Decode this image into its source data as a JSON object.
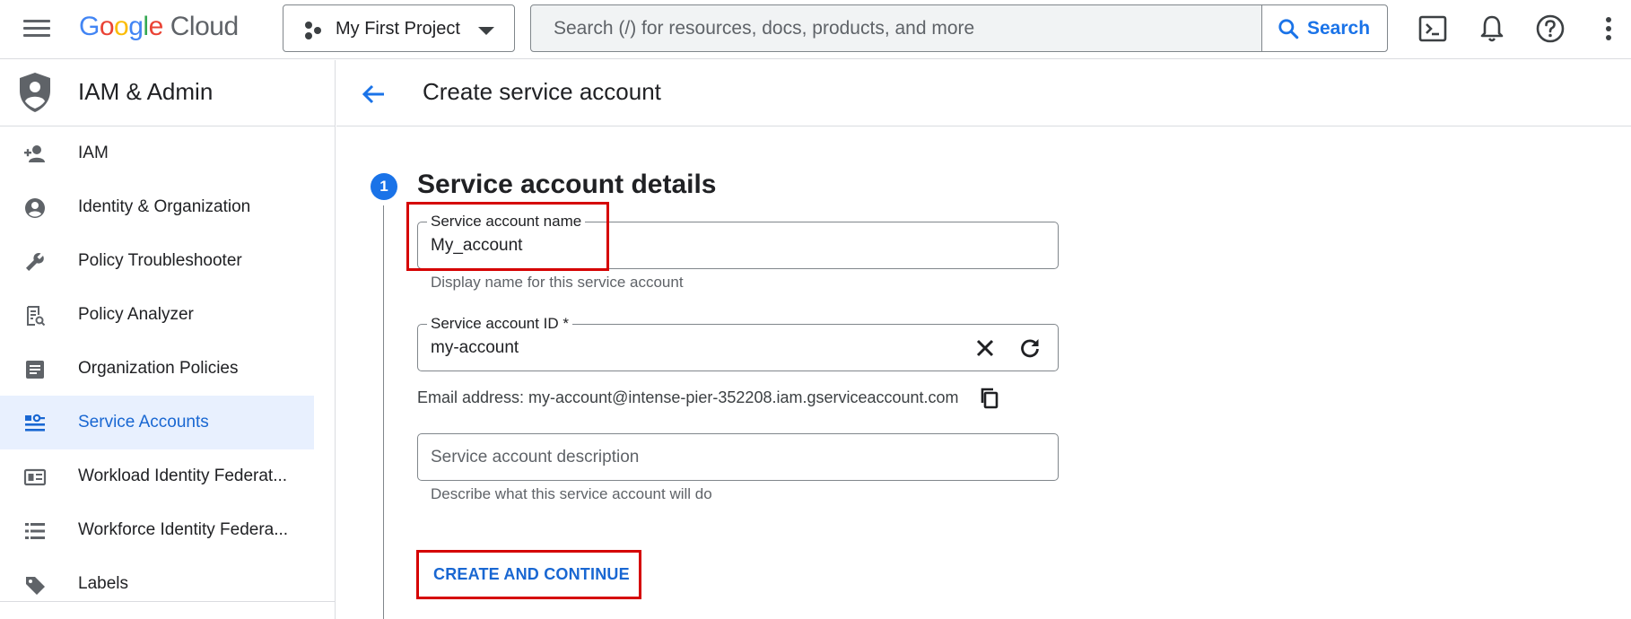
{
  "topbar": {
    "logo_google": "Google",
    "logo_cloud": "Cloud",
    "project_name": "My First Project",
    "search_placeholder": "Search (/) for resources, docs, products, and more",
    "search_button": "Search",
    "icons": [
      "menu-icon",
      "cloud-shell-icon",
      "notifications-icon",
      "help-icon",
      "more-vert-icon"
    ]
  },
  "sidebar": {
    "title": "IAM & Admin",
    "items": [
      {
        "label": "IAM",
        "icon": "person-add-icon"
      },
      {
        "label": "Identity & Organization",
        "icon": "account-circle-icon"
      },
      {
        "label": "Policy Troubleshooter",
        "icon": "wrench-icon"
      },
      {
        "label": "Policy Analyzer",
        "icon": "policy-doc-icon"
      },
      {
        "label": "Organization Policies",
        "icon": "article-icon"
      },
      {
        "label": "Service Accounts",
        "icon": "service-account-icon",
        "active": true
      },
      {
        "label": "Workload Identity Federat...",
        "icon": "id-card-icon"
      },
      {
        "label": "Workforce Identity Federa...",
        "icon": "list-icon"
      },
      {
        "label": "Labels",
        "icon": "label-icon"
      }
    ]
  },
  "page": {
    "title": "Create service account",
    "step_number": "1",
    "section_title": "Service account details",
    "name_field": {
      "label": "Service account name",
      "value": "My_account",
      "helper": "Display name for this service account"
    },
    "id_field": {
      "label": "Service account ID *",
      "value": "my-account"
    },
    "email_text": "Email address: my-account@intense-pier-352208.iam.gserviceaccount.com",
    "description_field": {
      "placeholder": "Service account description",
      "helper": "Describe what this service account will do"
    },
    "create_button": "CREATE AND CONTINUE"
  },
  "colors": {
    "accent": "#1a73e8",
    "active_nav_bg": "#e8f0fe",
    "highlight_box": "#d50000"
  }
}
